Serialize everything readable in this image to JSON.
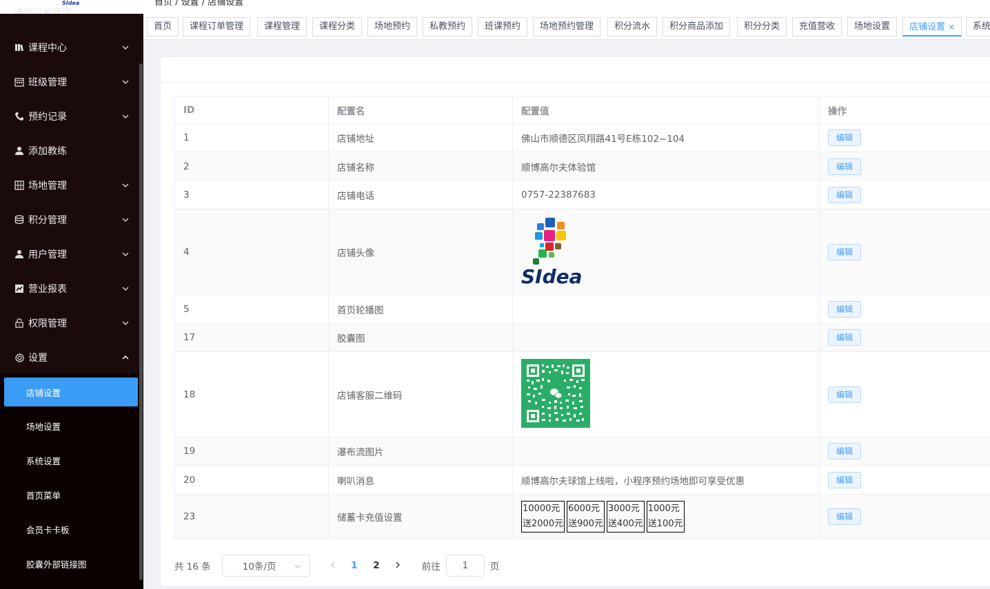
{
  "sidebar": {
    "logo_text": "SIdea",
    "clipped_item": "课程订单管理",
    "menu": [
      {
        "label": "课程中心",
        "icon": "library-icon"
      },
      {
        "label": "班级管理",
        "icon": "calendar-icon"
      },
      {
        "label": "预约记录",
        "icon": "phone-icon"
      },
      {
        "label": "添加教练",
        "icon": "user-icon"
      },
      {
        "label": "场地管理",
        "icon": "grid-icon"
      },
      {
        "label": "积分管理",
        "icon": "database-icon"
      },
      {
        "label": "用户管理",
        "icon": "user-icon"
      },
      {
        "label": "营业报表",
        "icon": "chart-icon"
      },
      {
        "label": "权限管理",
        "icon": "lock-icon"
      },
      {
        "label": "设置",
        "icon": "gear-icon"
      }
    ],
    "submenu": [
      {
        "label": "店铺设置",
        "active": true
      },
      {
        "label": "场地设置"
      },
      {
        "label": "系统设置"
      },
      {
        "label": "首页菜单"
      },
      {
        "label": "会员卡卡板"
      },
      {
        "label": "胶囊外部链接图"
      }
    ]
  },
  "breadcrumb": "首页 / 设置 / 店铺设置",
  "tabs": [
    "首页",
    "课程订单管理",
    "课程管理",
    "课程分类",
    "场地预约",
    "私教预约",
    "班课预约",
    "场地预约管理",
    "积分流水",
    "积分商品添加",
    "积分分类",
    "充值营收",
    "场地设置",
    "店铺设置",
    "系统"
  ],
  "active_tab": "店铺设置",
  "table": {
    "headers": [
      "ID",
      "配置名",
      "配置值",
      "操作"
    ],
    "rows": [
      {
        "id": "1",
        "name": "店铺地址",
        "value": "佛山市顺德区凤翔路41号E栋102~104"
      },
      {
        "id": "2",
        "name": "店铺名称",
        "value": "顺博高尔夫体验馆"
      },
      {
        "id": "3",
        "name": "店铺电话",
        "value": "0757-22387683"
      },
      {
        "id": "4",
        "name": "店铺头像",
        "value": ""
      },
      {
        "id": "5",
        "name": "首页轮播图",
        "value": ""
      },
      {
        "id": "17",
        "name": "胶囊图",
        "value": ""
      },
      {
        "id": "18",
        "name": "店铺客服二维码",
        "value": ""
      },
      {
        "id": "19",
        "name": "瀑布流图片",
        "value": ""
      },
      {
        "id": "20",
        "name": "喇叭消息",
        "value": "顺博高尔夫球馆上线啦，小程序预约场地即可享受优惠"
      },
      {
        "id": "23",
        "name": "储蓄卡充值设置",
        "value": ""
      }
    ],
    "edit_label": "编辑",
    "avatar_logo_text": "SIdea",
    "recharge_options": [
      {
        "amount": "10000元",
        "bonus": "送2000元"
      },
      {
        "amount": "6000元",
        "bonus": "送900元"
      },
      {
        "amount": "3000元",
        "bonus": "送400元"
      },
      {
        "amount": "1000元",
        "bonus": "送100元"
      }
    ]
  },
  "pagination": {
    "total": "共 16 条",
    "page_size": "10条/页",
    "pages": [
      "1",
      "2"
    ],
    "current": "1",
    "goto_prefix": "前往",
    "goto_value": "1",
    "goto_suffix": "页"
  },
  "colors": {
    "sidebar_bg": "#1a0a0a",
    "active_blue": "#409eff",
    "submenu_active": "#3a9cf5",
    "qr_green": "#2aae67"
  }
}
